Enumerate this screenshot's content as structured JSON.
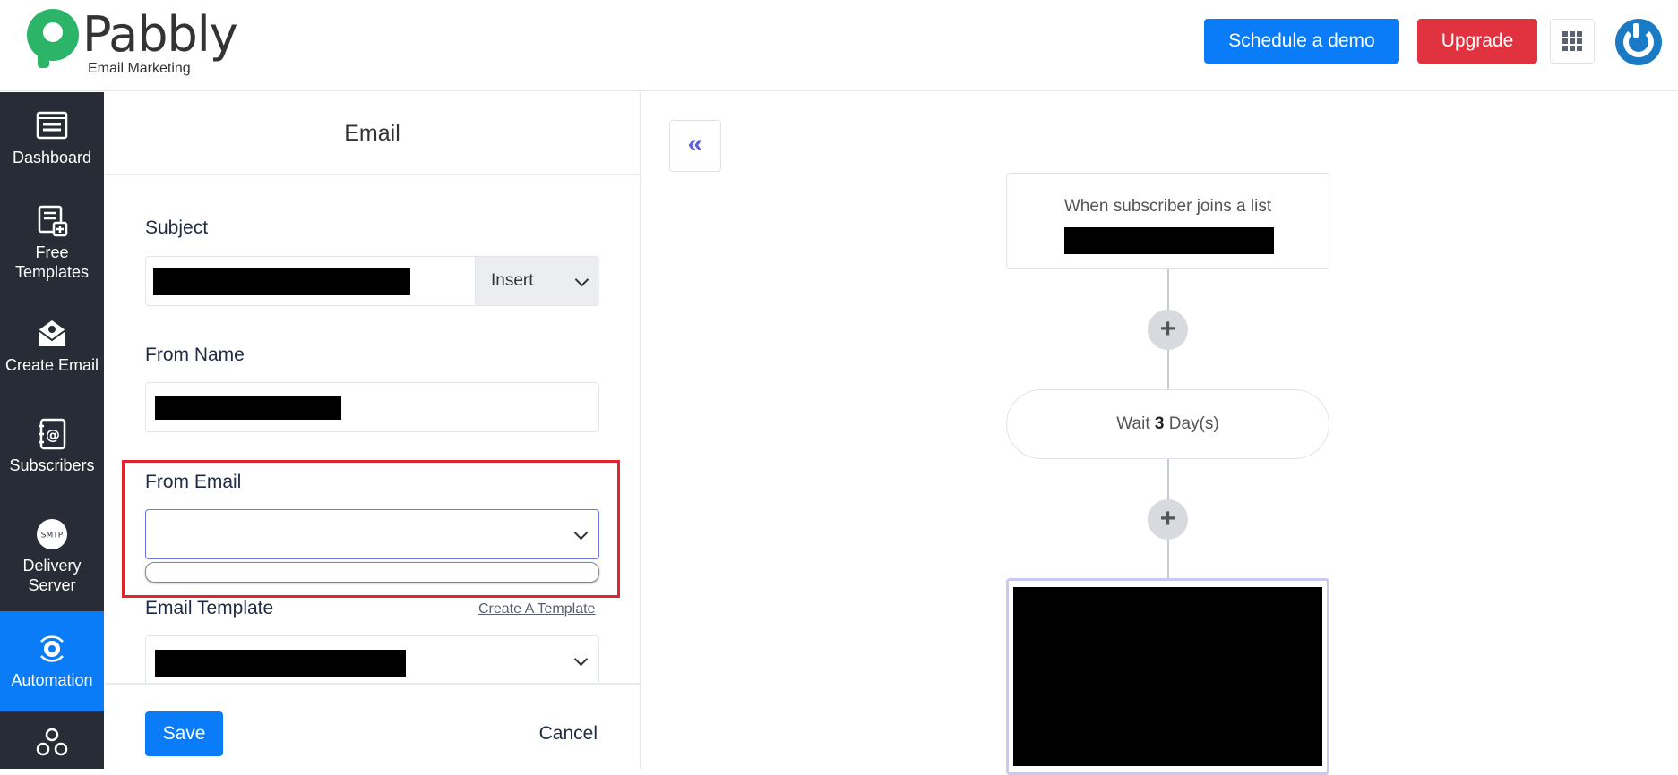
{
  "header": {
    "brand": "Pabbly",
    "brand_sub": "Email Marketing",
    "demo_label": "Schedule a demo",
    "upgrade_label": "Upgrade"
  },
  "sidebar": {
    "items": [
      {
        "label": "Dashboard",
        "icon": "dashboard-icon"
      },
      {
        "label": "Free Templates",
        "icon": "templates-icon"
      },
      {
        "label": "Create Email",
        "icon": "create-email-icon"
      },
      {
        "label": "Subscribers",
        "icon": "subscribers-icon"
      },
      {
        "label": "Delivery Server",
        "icon": "smtp-icon",
        "icon_text": "SMTP"
      },
      {
        "label": "Automation",
        "icon": "automation-icon",
        "active": true
      },
      {
        "label": "",
        "icon": "webhook-icon"
      }
    ]
  },
  "panel": {
    "title": "Email",
    "subject_label": "Subject",
    "insert_label": "Insert",
    "from_name_label": "From Name",
    "from_email_label": "From Email",
    "from_email_value": "",
    "template_label": "Email Template",
    "create_template_link": "Create A Template",
    "save_label": "Save",
    "cancel_label": "Cancel"
  },
  "canvas": {
    "collapse_glyph": "«",
    "trigger_text": "When subscriber joins a list",
    "wait_prefix": "Wait",
    "wait_count": "3",
    "wait_unit": "Day(s)",
    "plus_glyph": "+"
  },
  "colors": {
    "primary": "#0a7cf7",
    "danger": "#e0323f",
    "sidebar_bg": "#272c36",
    "highlight": "#e2242f",
    "brand_green": "#2cb468"
  }
}
